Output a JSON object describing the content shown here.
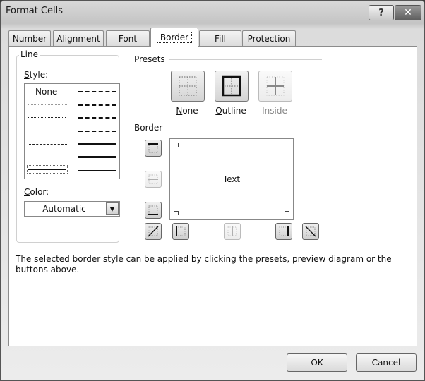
{
  "window": {
    "title": "Format Cells",
    "help_label": "?",
    "close_label": "✕"
  },
  "tabs": [
    {
      "label": "Number",
      "active": false
    },
    {
      "label": "Alignment",
      "active": false
    },
    {
      "label": "Font",
      "active": false
    },
    {
      "label": "Border",
      "active": true
    },
    {
      "label": "Fill",
      "active": false
    },
    {
      "label": "Protection",
      "active": false
    }
  ],
  "line": {
    "group_label": "Line",
    "style_label_accel": "S",
    "style_label_rest": "tyle:",
    "style_none_label": "None",
    "styles": [
      "none",
      "hair",
      "dotted",
      "dash-dot-dot",
      "dash-dot",
      "dashed",
      "double-selected",
      "medium-dash-dot-dot",
      "slant-dash-dot",
      "medium-dash-dot",
      "medium-dashed",
      "medium",
      "thick",
      "double"
    ],
    "selected_style": "thin",
    "color_label_accel": "C",
    "color_label_rest": "olor:",
    "color_value": "Automatic"
  },
  "presets": {
    "label": "Presets",
    "items": [
      {
        "accel": "N",
        "rest": "one",
        "disabled": false,
        "icon": "preset-none-icon"
      },
      {
        "accel": "O",
        "rest": "utline",
        "disabled": false,
        "icon": "preset-outline-icon"
      },
      {
        "accel": "",
        "rest": "Inside",
        "disabled": true,
        "icon": "preset-inside-icon"
      }
    ]
  },
  "border": {
    "label": "Border",
    "preview_text": "Text",
    "buttons": [
      {
        "name": "border-top",
        "disabled": false
      },
      {
        "name": "border-inside-horizontal",
        "disabled": true
      },
      {
        "name": "border-bottom",
        "disabled": false
      },
      {
        "name": "border-diagonal-up",
        "disabled": false
      },
      {
        "name": "border-left",
        "disabled": false
      },
      {
        "name": "border-inside-vertical",
        "disabled": true
      },
      {
        "name": "border-right",
        "disabled": false
      },
      {
        "name": "border-diagonal-down",
        "disabled": false
      }
    ]
  },
  "hint_text": "The selected border style can be applied by clicking the presets, preview diagram or the buttons above.",
  "footer": {
    "ok_label": "OK",
    "cancel_label": "Cancel"
  }
}
